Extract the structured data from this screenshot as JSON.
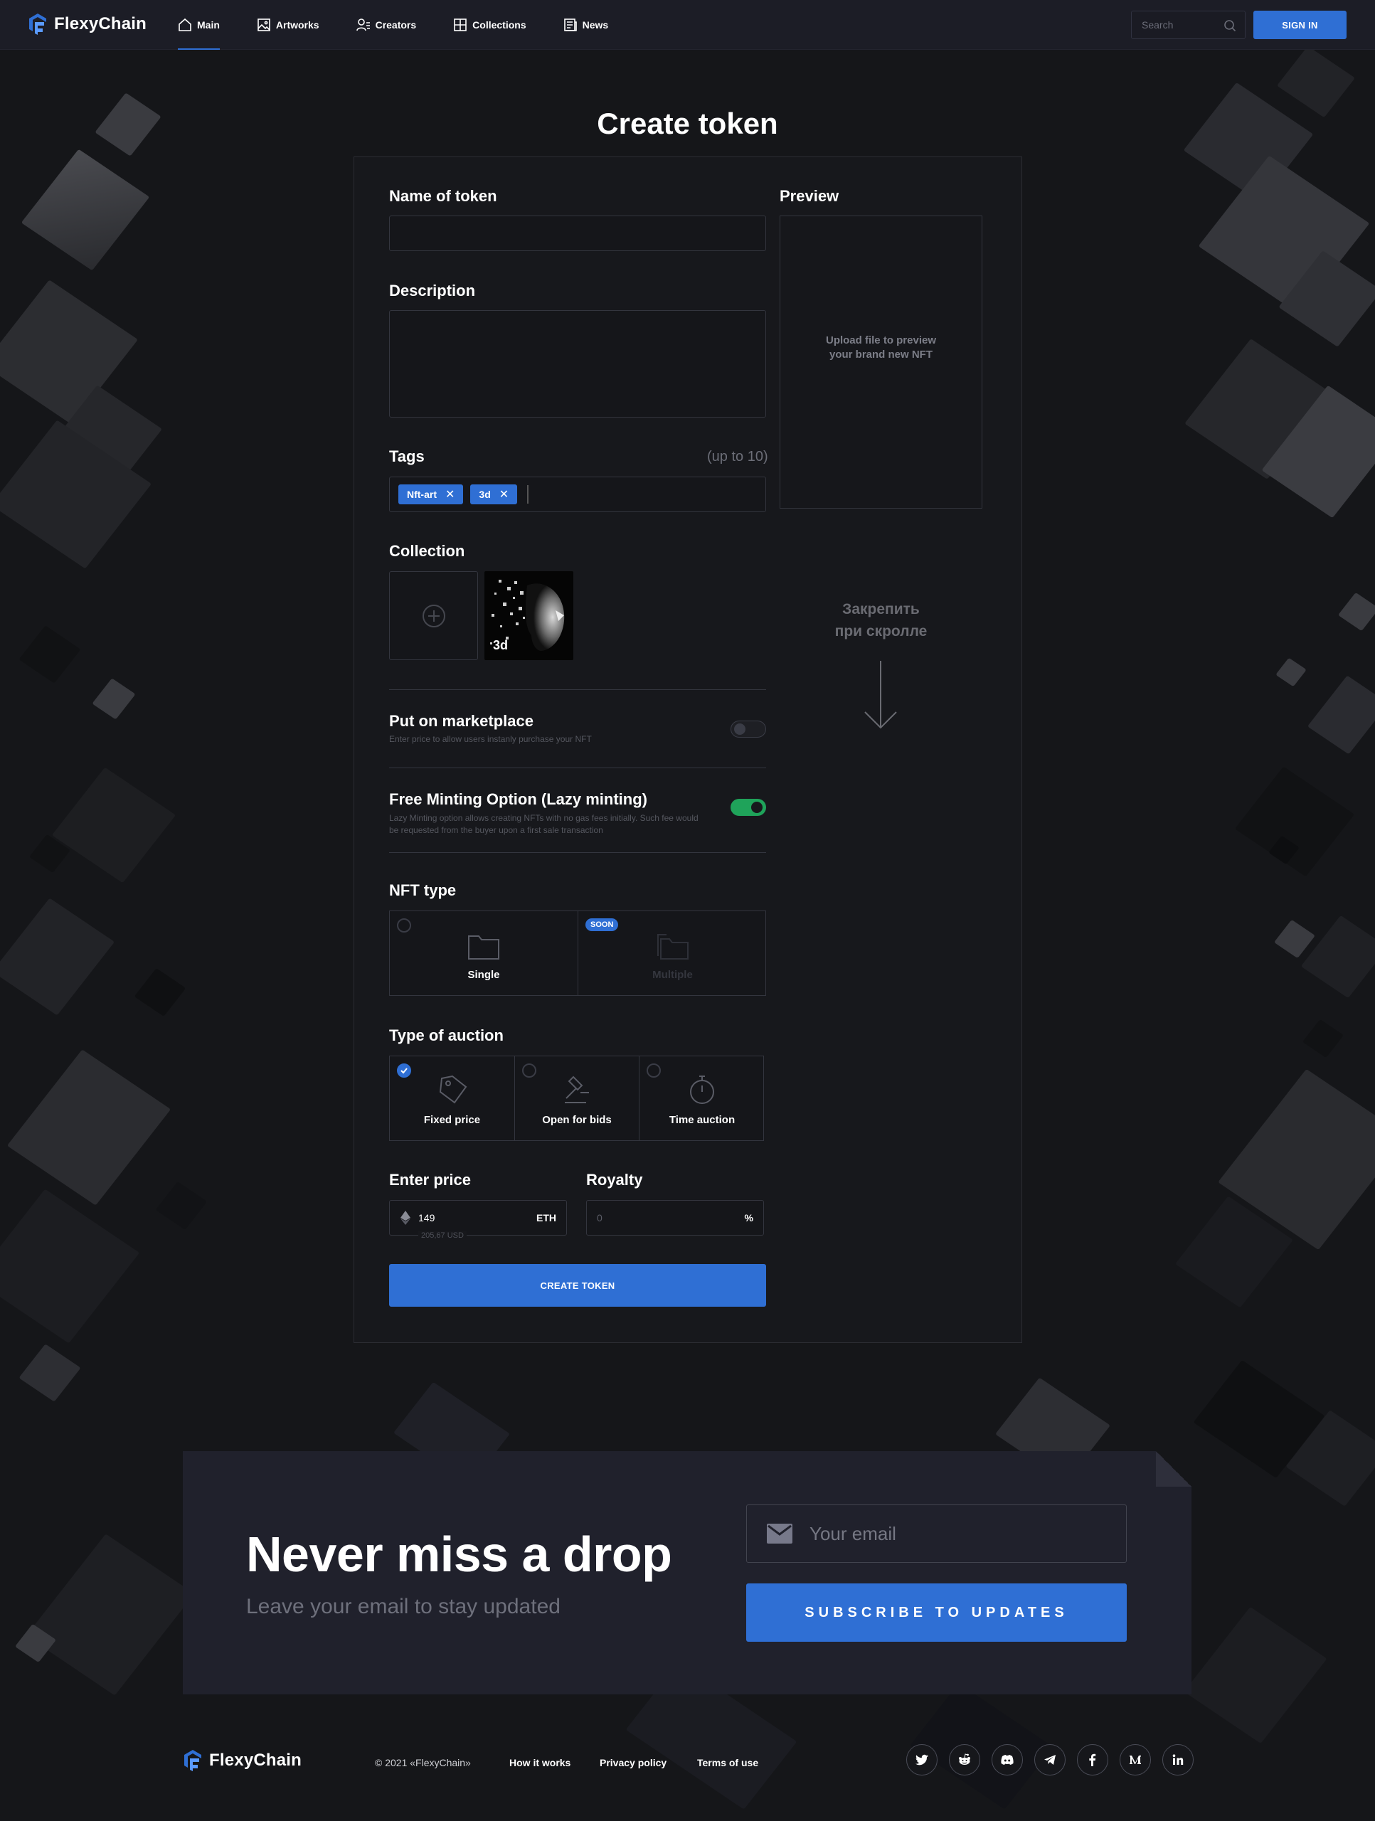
{
  "app": {
    "name": "FlexyChain"
  },
  "nav": {
    "items": [
      {
        "label": "Main",
        "icon": "home-icon",
        "active": true
      },
      {
        "label": "Artworks",
        "icon": "image-icon",
        "active": false
      },
      {
        "label": "Creators",
        "icon": "user-list-icon",
        "active": false
      },
      {
        "label": "Collections",
        "icon": "grid-icon",
        "active": false
      },
      {
        "label": "News",
        "icon": "newspaper-icon",
        "active": false
      }
    ],
    "search_placeholder": "Search",
    "sign_in_label": "SIGN IN"
  },
  "form": {
    "title": "Create token",
    "name_label": "Name of token",
    "name_value": "",
    "description_label": "Description",
    "description_value": "",
    "tags_label": "Tags",
    "tags_hint": "(up to 10)",
    "tags": [
      "Nft-art",
      "3d"
    ],
    "collection_label": "Collection",
    "collection_item_label": "3d",
    "marketplace_title": "Put on marketplace",
    "marketplace_sub": "Enter price to allow users instanly purchase your NFT",
    "marketplace_on": false,
    "lazy_title": "Free Minting Option (Lazy minting)",
    "lazy_sub": "Lazy Minting option allows creating NFTs with no gas fees initially. Such fee would be requested from the buyer upon a first sale transaction",
    "lazy_on": true,
    "nft_type_label": "NFT type",
    "nft_types": [
      {
        "label": "Single",
        "selected": false
      },
      {
        "label": "Multiple",
        "badge": "SOON",
        "disabled": true
      }
    ],
    "auction_label": "Type of auction",
    "auctions": [
      {
        "label": "Fixed price",
        "selected": true
      },
      {
        "label": "Open for bids",
        "selected": false
      },
      {
        "label": "Time auction",
        "selected": false
      }
    ],
    "price_label": "Enter price",
    "price_value": "149",
    "price_currency": "ETH",
    "price_usd": "205,67 USD",
    "royalty_label": "Royalty",
    "royalty_placeholder": "0",
    "royalty_unit": "%",
    "create_label": "CREATE TOKEN",
    "preview_label": "Preview",
    "preview_text": "Upload file to preview your brand new NFT",
    "pin_note_1": "Закрепить",
    "pin_note_2": "при скролле"
  },
  "subscribe": {
    "title": "Never miss a drop",
    "subtitle": "Leave your email to stay updated",
    "email_placeholder": "Your email",
    "button_label": "SUBSCRIBE TO UPDATES"
  },
  "footer": {
    "copyright": "© 2021 «FlexyChain»",
    "links": [
      "How it works",
      "Privacy policy",
      "Terms of use"
    ],
    "socials": [
      "twitter-icon",
      "reddit-icon",
      "discord-icon",
      "telegram-icon",
      "facebook-icon",
      "medium-icon",
      "linkedin-icon"
    ]
  },
  "colors": {
    "accent": "#2f6fd4",
    "toggle_on": "#1fa35a",
    "background": "#151619",
    "card": "#17181c",
    "subscribe_bg": "#20212c"
  }
}
